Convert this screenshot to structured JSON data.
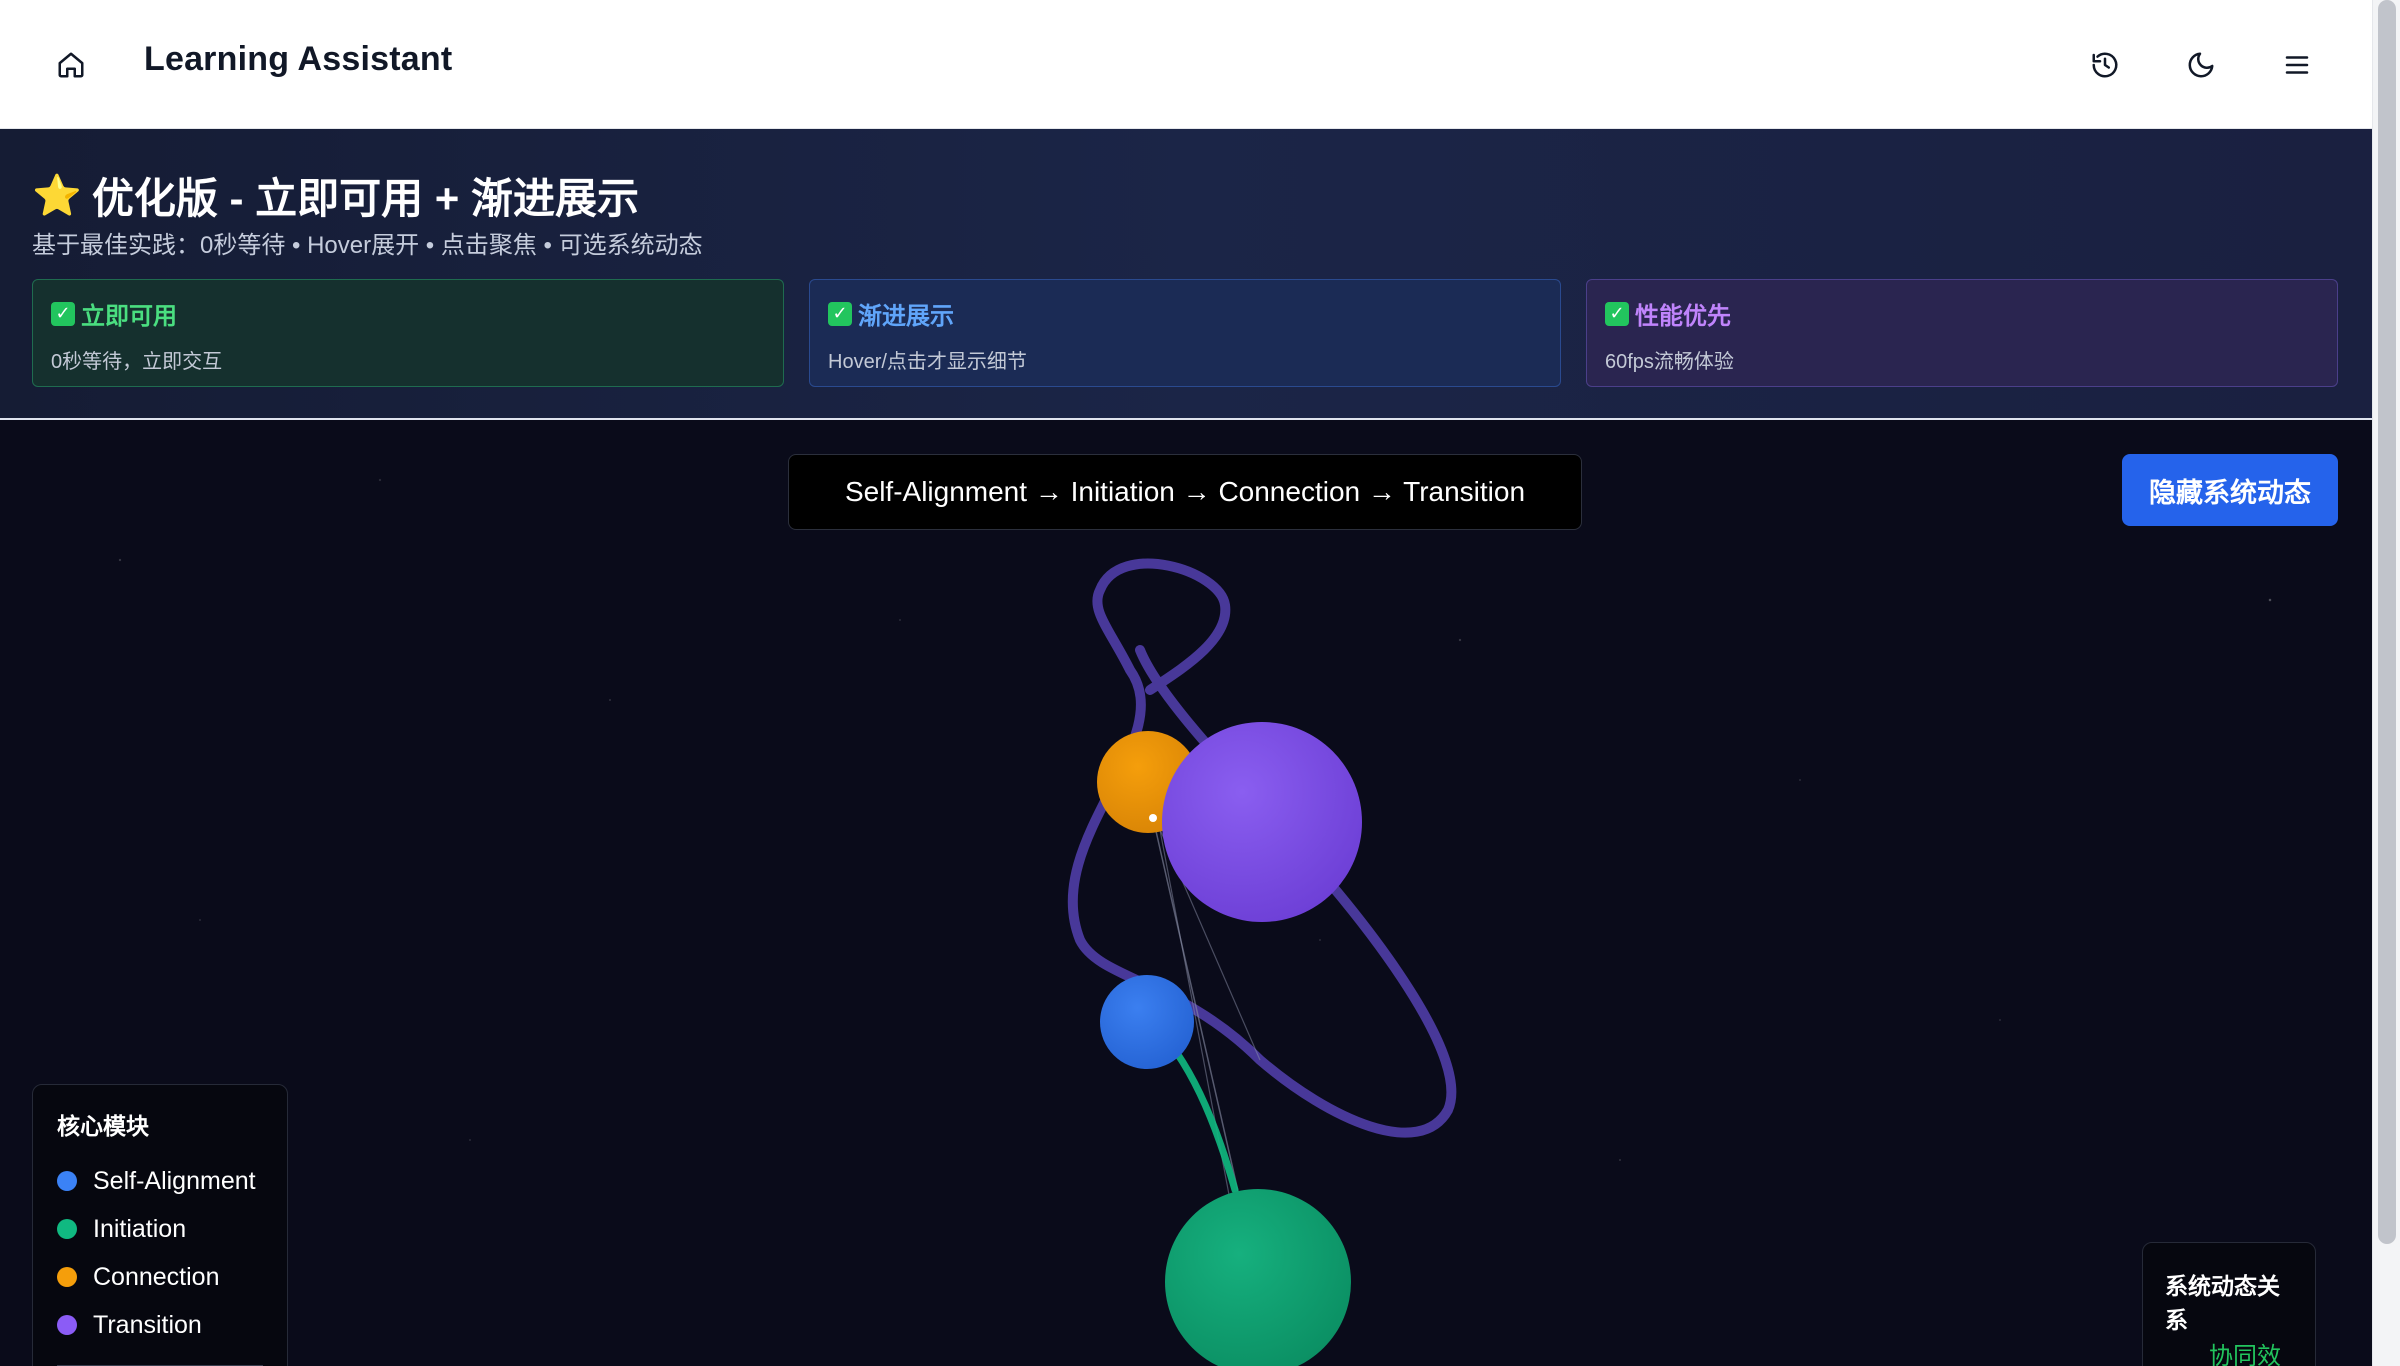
{
  "app": {
    "title": "Learning Assistant",
    "icons": {
      "home": "home-icon",
      "history": "history-icon",
      "theme": "moon-icon",
      "menu": "hamburger-menu-icon"
    }
  },
  "banner": {
    "star_icon": "⭐",
    "headline": "优化版 - 立即可用 + 渐进展示",
    "subline": "基于最佳实践：0秒等待 • Hover展开 • 点击聚焦 • 可选系统动态",
    "cards": [
      {
        "check": "✓",
        "title": "立即可用",
        "desc": "0秒等待，立即交互",
        "accent": "#4ade80"
      },
      {
        "check": "✓",
        "title": "渐进展示",
        "desc": "Hover/点击才显示细节",
        "accent": "#60a5fa"
      },
      {
        "check": "✓",
        "title": "性能优先",
        "desc": "60fps流畅体验",
        "accent": "#c084fc"
      }
    ]
  },
  "main": {
    "flow_label": "Self-Alignment → Initiation → Connection → Transition",
    "toggle_button": "隐藏系统动态"
  },
  "graph": {
    "nodes": [
      {
        "id": "self-alignment",
        "color": "#3b82f6"
      },
      {
        "id": "initiation",
        "color": "#10b981"
      },
      {
        "id": "connection",
        "color": "#f59e0b"
      },
      {
        "id": "transition",
        "color": "#8b5cf6"
      }
    ],
    "edge_colors": {
      "loop": "#4c3ba0",
      "synergy": "#10b981"
    }
  },
  "legend": {
    "title": "核心模块",
    "items": [
      {
        "label": "Self-Alignment",
        "color": "#3b82f6"
      },
      {
        "label": "Initiation",
        "color": "#10b981"
      },
      {
        "label": "Connection",
        "color": "#f59e0b"
      },
      {
        "label": "Transition",
        "color": "#8b5cf6"
      }
    ]
  },
  "relations": {
    "title": "系统动态关系",
    "items": [
      {
        "label": "协同效应",
        "color": "#22c55e"
      }
    ]
  }
}
